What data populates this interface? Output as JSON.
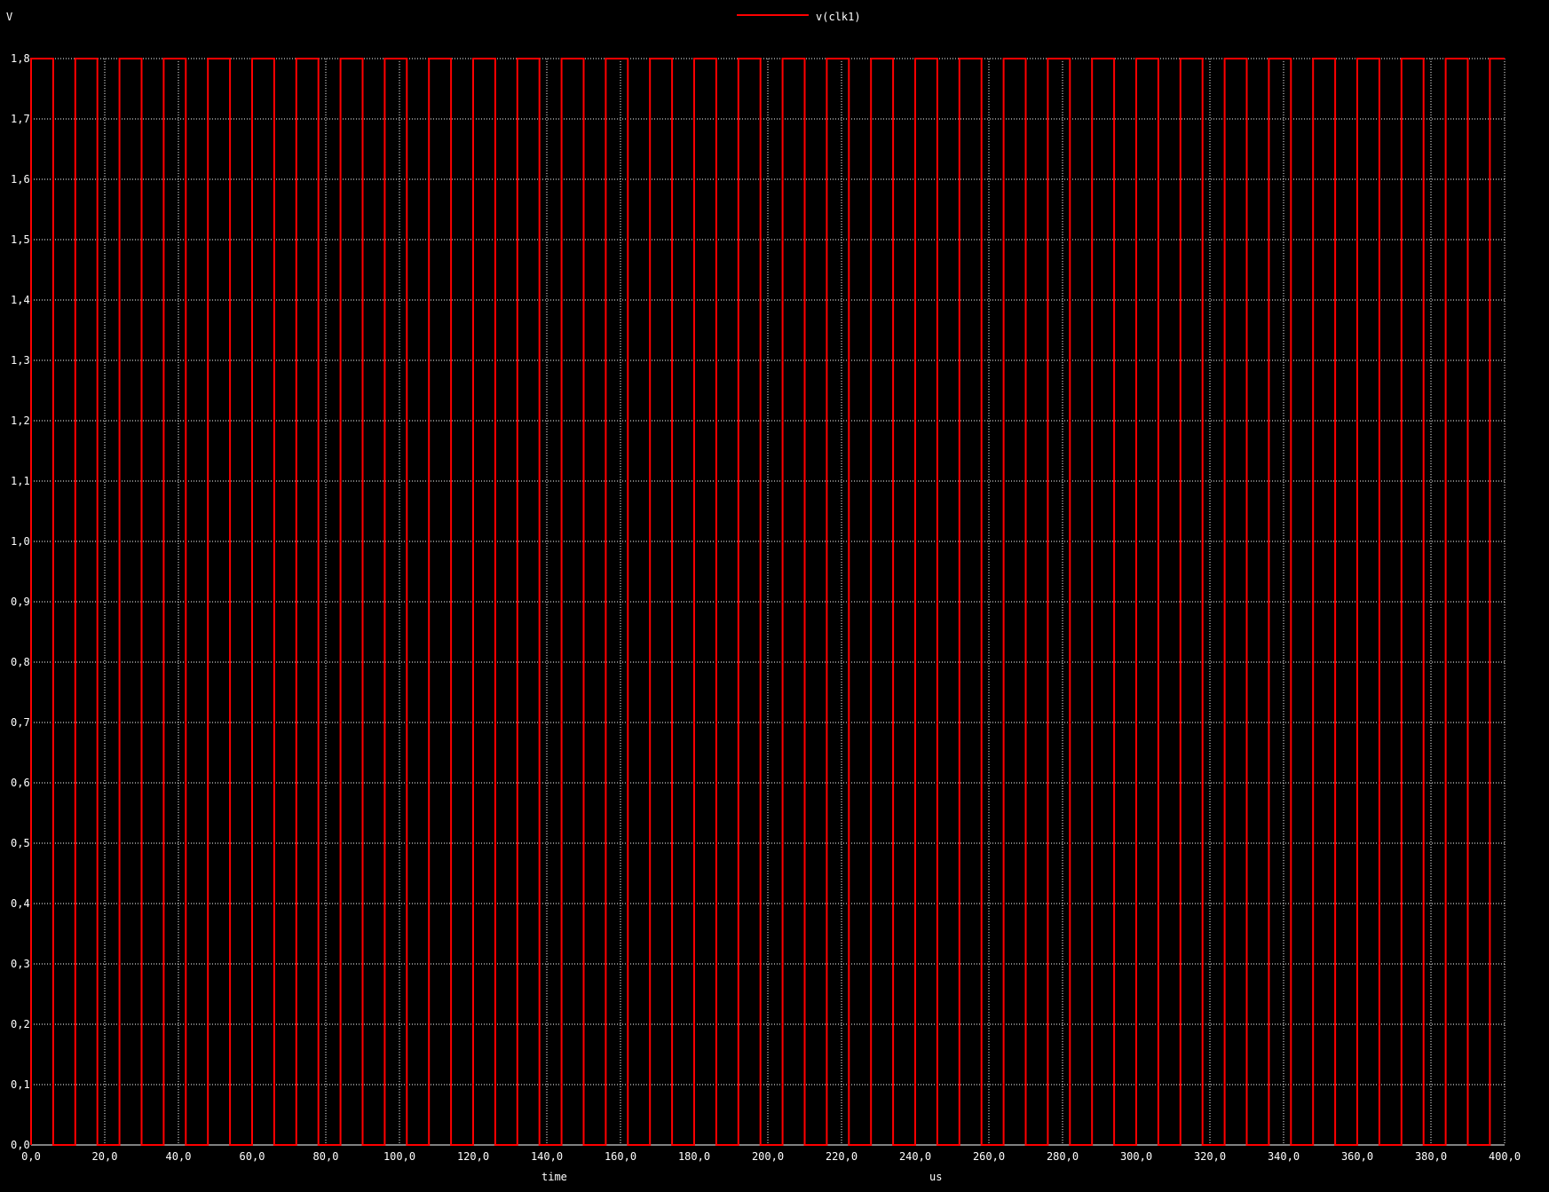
{
  "chart_data": {
    "type": "line",
    "ylabel": "V",
    "xlabel": "time",
    "xunit": "us",
    "xlim": [
      0,
      400
    ],
    "ylim": [
      0,
      1.8
    ],
    "x_ticks": [
      0,
      20,
      40,
      60,
      80,
      100,
      120,
      140,
      160,
      180,
      200,
      220,
      240,
      260,
      280,
      300,
      320,
      340,
      360,
      380,
      400
    ],
    "x_tick_labels": [
      "0,0",
      "20,0",
      "40,0",
      "60,0",
      "80,0",
      "100,0",
      "120,0",
      "140,0",
      "160,0",
      "180,0",
      "200,0",
      "220,0",
      "240,0",
      "260,0",
      "280,0",
      "300,0",
      "320,0",
      "340,0",
      "360,0",
      "380,0",
      "400,0"
    ],
    "y_ticks": [
      0,
      0.1,
      0.2,
      0.3,
      0.4,
      0.5,
      0.6,
      0.7,
      0.8,
      0.9,
      1.0,
      1.1,
      1.2,
      1.3,
      1.4,
      1.5,
      1.6,
      1.7,
      1.8
    ],
    "y_tick_labels": [
      "0,0",
      "0,1",
      "0,2",
      "0,3",
      "0,4",
      "0,5",
      "0,6",
      "0,7",
      "0,8",
      "0,9",
      "1,0",
      "1,1",
      "1,2",
      "1,3",
      "1,4",
      "1,5",
      "1,6",
      "1,7",
      "1,8"
    ],
    "grid": true,
    "legend_position": "top-center",
    "background": "#000000",
    "grid_color": "#ffffff",
    "series": [
      {
        "name": "v(clk1)",
        "color": "#ff0000",
        "waveform": "square",
        "low": 0,
        "high": 1.8,
        "period": 12,
        "high_time": 6,
        "first_high_start": 0,
        "end": 400
      }
    ]
  }
}
